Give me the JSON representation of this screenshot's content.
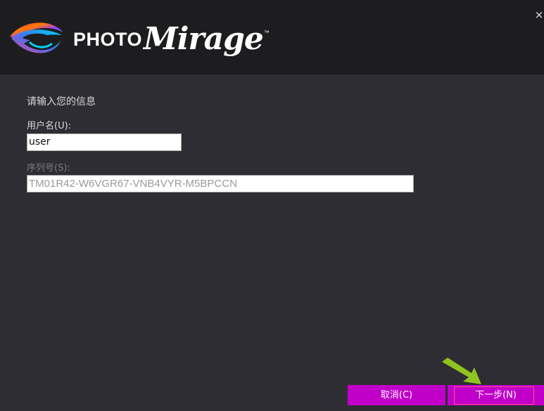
{
  "header": {
    "brand_photo": "PHOTO",
    "brand_mirage": "Mirage",
    "brand_tm": "™",
    "close_glyph": "×"
  },
  "form": {
    "title": "请输入您的信息",
    "username_label": "用户名(U):",
    "username_value": "user",
    "serial_label": "序列号(S):",
    "serial_value": "TM01R42-W6VGR67-VNB4VYR-M5BPCCN"
  },
  "buttons": {
    "cancel_label": "取消(C)",
    "next_label": "下一步(N)"
  },
  "colors": {
    "accent": "#c000c8",
    "header_bg": "#1d1d1f",
    "body_bg": "#2e2d33",
    "pointer_arrow": "#8fc31f",
    "focus_ring": "#ff4d8a"
  },
  "icons": {
    "logo": "photomirage-logo-icon",
    "close": "close-icon",
    "pointer": "pointer-arrow-icon"
  }
}
